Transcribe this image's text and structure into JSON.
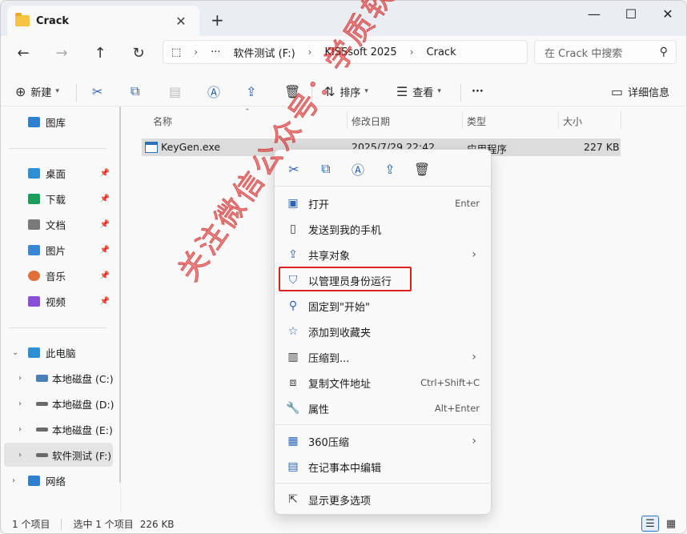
{
  "window": {
    "tab_title": "Crack",
    "tab_close": "✕",
    "new_tab": "+",
    "minimize": "—",
    "maximize": "☐",
    "close": "✕"
  },
  "nav": {
    "back": "←",
    "forward": "→",
    "up": "↑",
    "refresh": "↻",
    "breadcrumb": [
      "⬚",
      "›",
      "···",
      "软件测试 (F:)",
      "›",
      "KISSsoft 2025",
      "›",
      "Crack"
    ],
    "search_placeholder": "在 Crack 中搜索",
    "search_icon": "⚲"
  },
  "toolbar": {
    "new_label": "新建",
    "sort_label": "排序",
    "view_label": "查看",
    "more": "···",
    "details_label": "详细信息"
  },
  "sidebar": {
    "top_item": "图库",
    "quick": [
      {
        "label": "桌面",
        "icon": "desktop-icon",
        "color": "#2f8fd6"
      },
      {
        "label": "下载",
        "icon": "download-icon",
        "color": "#1a9e5c"
      },
      {
        "label": "文档",
        "icon": "document-icon",
        "color": "#7a7a7a"
      },
      {
        "label": "图片",
        "icon": "pictures-icon",
        "color": "#3a86d6"
      },
      {
        "label": "音乐",
        "icon": "music-icon",
        "color": "#e0703a"
      },
      {
        "label": "视频",
        "icon": "video-icon",
        "color": "#8a4fd6"
      }
    ],
    "this_pc": "此电脑",
    "drives": [
      {
        "label": "本地磁盘 (C:)"
      },
      {
        "label": "本地磁盘 (D:)"
      },
      {
        "label": "本地磁盘 (E:)"
      },
      {
        "label": "软件测试 (F:)"
      }
    ],
    "network": "网络"
  },
  "files": {
    "columns": [
      "名称",
      "修改日期",
      "类型",
      "大小"
    ],
    "rows": [
      {
        "name": "KeyGen.exe",
        "date": "2025/7/29 22:42",
        "type": "应用程序",
        "size": "227 KB"
      }
    ]
  },
  "context_menu": {
    "quick_actions": [
      "cut-icon",
      "copy-icon",
      "rename-icon",
      "share-icon",
      "delete-icon"
    ],
    "items": [
      {
        "label": "打开",
        "key": "Enter",
        "icon": "open-icon"
      },
      {
        "label": "发送到我的手机",
        "key": "",
        "icon": "phone-icon"
      },
      {
        "label": "共享对象",
        "key": "",
        "icon": "share-icon",
        "submenu": true
      },
      {
        "label": "以管理员身份运行",
        "key": "",
        "icon": "shield-icon"
      },
      {
        "label": "固定到\"开始\"",
        "key": "",
        "icon": "pin-icon"
      },
      {
        "label": "添加到收藏夹",
        "key": "",
        "icon": "star-icon"
      },
      {
        "label": "压缩到...",
        "key": "",
        "icon": "zip-icon",
        "submenu": true
      },
      {
        "label": "复制文件地址",
        "key": "Ctrl+Shift+C",
        "icon": "copy-path-icon"
      },
      {
        "label": "属性",
        "key": "Alt+Enter",
        "icon": "wrench-icon"
      },
      {
        "label": "360压缩",
        "key": "",
        "icon": "360-zip-icon",
        "submenu": true
      },
      {
        "label": "在记事本中编辑",
        "key": "",
        "icon": "notepad-icon"
      },
      {
        "label": "显示更多选项",
        "key": "",
        "icon": "more-options-icon"
      }
    ]
  },
  "status": {
    "count": "1 个项目",
    "selected": "选中 1 个项目",
    "size": "226 KB"
  },
  "watermark": "关注微信公众号：学质软件管家",
  "colors": {
    "accent": "#2c63b5",
    "highlight_box": "#e0201f",
    "watermark": "#dc2828"
  }
}
